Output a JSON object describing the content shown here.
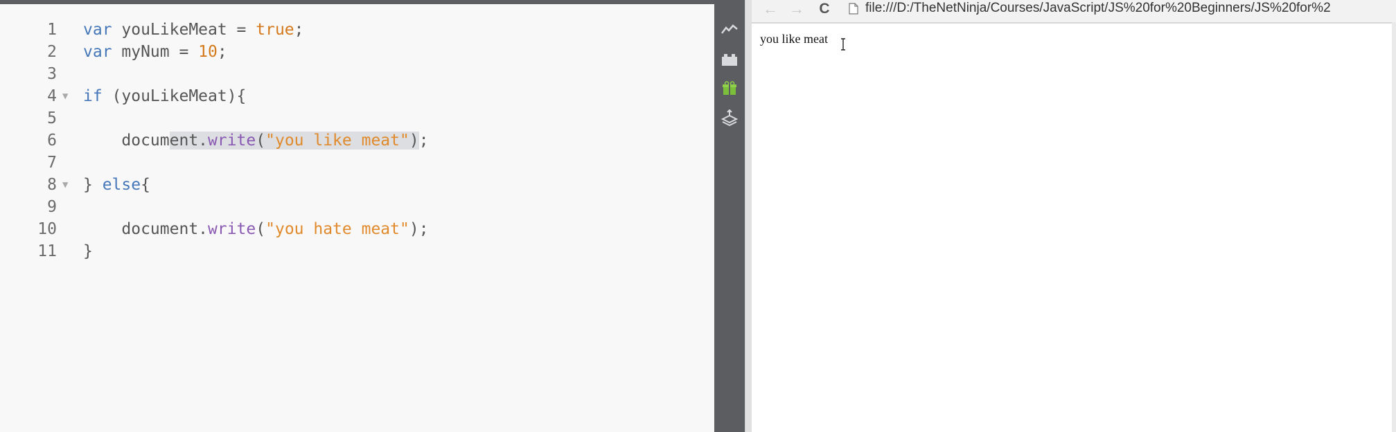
{
  "editor": {
    "lines": [
      {
        "num": "1",
        "tokens": [
          {
            "t": "var ",
            "c": "k"
          },
          {
            "t": "youLikeMeat = ",
            "c": "v"
          },
          {
            "t": "true",
            "c": "b"
          },
          {
            "t": ";",
            "c": "v"
          }
        ]
      },
      {
        "num": "2",
        "tokens": [
          {
            "t": "var ",
            "c": "k"
          },
          {
            "t": "myNum = ",
            "c": "v"
          },
          {
            "t": "10",
            "c": "n"
          },
          {
            "t": ";",
            "c": "v"
          }
        ]
      },
      {
        "num": "3",
        "tokens": []
      },
      {
        "num": "4",
        "fold": true,
        "tokens": [
          {
            "t": "if ",
            "c": "k"
          },
          {
            "t": "(youLikeMeat){",
            "c": "v"
          }
        ]
      },
      {
        "num": "5",
        "tokens": []
      },
      {
        "num": "6",
        "tokens": [
          {
            "t": "    docum",
            "c": "v"
          },
          {
            "t": "ent.",
            "c": "v sel"
          },
          {
            "t": "write",
            "c": "f sel"
          },
          {
            "t": "(",
            "c": "v sel"
          },
          {
            "t": "\"you like meat\"",
            "c": "s sel"
          },
          {
            "t": ")",
            "c": "v sel"
          },
          {
            "t": ";",
            "c": "v"
          }
        ]
      },
      {
        "num": "7",
        "tokens": []
      },
      {
        "num": "8",
        "fold": true,
        "tokens": [
          {
            "t": "} ",
            "c": "v"
          },
          {
            "t": "else",
            "c": "k"
          },
          {
            "t": "{",
            "c": "v"
          }
        ]
      },
      {
        "num": "9",
        "tokens": []
      },
      {
        "num": "10",
        "tokens": [
          {
            "t": "    document.",
            "c": "v"
          },
          {
            "t": "write",
            "c": "f"
          },
          {
            "t": "(",
            "c": "v"
          },
          {
            "t": "\"you hate meat\"",
            "c": "s"
          },
          {
            "t": ");",
            "c": "v"
          }
        ]
      },
      {
        "num": "11",
        "tokens": [
          {
            "t": "}",
            "c": "v"
          }
        ]
      }
    ]
  },
  "toolstrip": {
    "icons": [
      "chart-line-icon",
      "plugin-block-icon",
      "gift-icon",
      "layers-upload-icon"
    ]
  },
  "browser": {
    "back_icon": "←",
    "forward_icon": "→",
    "reload_icon": "C",
    "address": "file:///D:/TheNetNinja/Courses/JavaScript/JS%20for%20Beginners/JS%20for%2",
    "page_output": "you like meat"
  },
  "colors": {
    "keyword": "#4677b8",
    "string": "#e08a2c",
    "function": "#8a5ab3",
    "selection": "#dcdee2"
  }
}
